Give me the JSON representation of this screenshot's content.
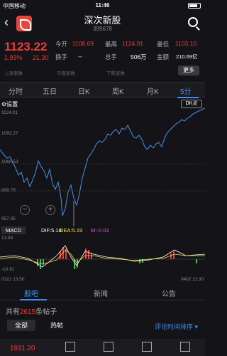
{
  "status": {
    "carrier": "中国移动",
    "time": "11:46"
  },
  "header": {
    "name": "深次新股",
    "code": "399678"
  },
  "quote": {
    "price": "1123.22",
    "change_pct": "1.93%",
    "change": "21.30",
    "open_label": "今开",
    "open": "1108.69",
    "high_label": "最高",
    "high": "1124.01",
    "low_label": "最低",
    "low": "1103.10",
    "turnover_label": "换手",
    "turnover": "--",
    "volume_label": "总手",
    "volume": "506万",
    "amount_label": "金额",
    "amount": "210.69亿",
    "up_label": "上涨家数",
    "flat_label": "平盘家数",
    "down_label": "下跌家数",
    "more_label": "更多"
  },
  "tabs": [
    "分时",
    "五日",
    "日K",
    "周K",
    "月K",
    "5分"
  ],
  "chart": {
    "settings_label": "设置",
    "dk_label": "DK点",
    "y_labels": [
      "1124.01",
      "1092.27",
      "1060.53",
      "998.79",
      "957.05"
    ]
  },
  "macd": {
    "label": "MACD",
    "dif": "DIF:5.18",
    "dea": "DEA:5.19",
    "m": "M:-0.03",
    "y_top": "13.93",
    "y_bottom": "-10.91",
    "date_left": "0321 13:50",
    "date_right": "0402 11:30"
  },
  "news_tabs": [
    "股吧",
    "新闻",
    "公告"
  ],
  "posts": {
    "prefix": "共有",
    "count": "2615",
    "suffix": "条帖子"
  },
  "filters": {
    "all": "全部",
    "hot": "热帖",
    "sort": "评论时间排序"
  },
  "bottom": {
    "price": "1911.20"
  },
  "colors": {
    "up": "#f03a3a",
    "accent": "#3b8ef0",
    "dea": "#f5e03a"
  }
}
